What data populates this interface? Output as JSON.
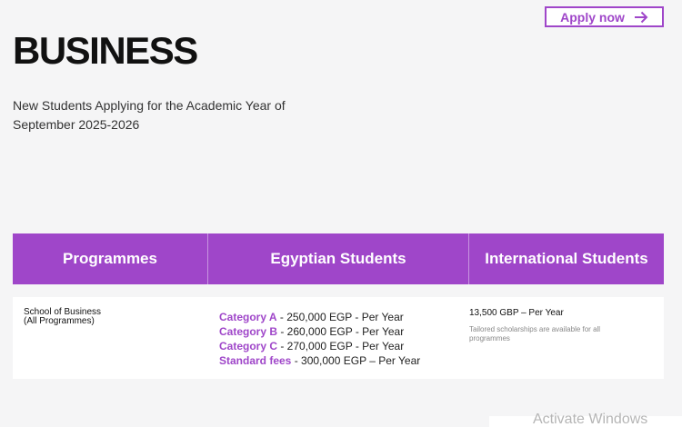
{
  "header": {
    "apply_label": "Apply now"
  },
  "page": {
    "title": "BUSINESS",
    "subtitle": "New Students Applying for the Academic Year of September 2025-2026"
  },
  "table": {
    "headers": [
      "Programmes",
      "Egyptian Students",
      "International Students"
    ],
    "row": {
      "programme_line1": "School of Business",
      "programme_line2": "(All Programmes)",
      "egyptian_fees": [
        {
          "category": "Category A",
          "fee": " - 250,000 EGP - Per Year"
        },
        {
          "category": "Category B",
          "fee": " - 260,000 EGP - Per Year"
        },
        {
          "category": "Category C",
          "fee": " - 270,000 EGP - Per Year"
        },
        {
          "category": "Standard fees",
          "fee": " - 300,000 EGP – Per Year"
        }
      ],
      "international_price": "13,500 GBP – Per Year",
      "international_note": "Tailored scholarships are available for all programmes"
    }
  },
  "overlay": {
    "watermark": "Activate Windows"
  },
  "colors": {
    "accent": "#9f46c9",
    "background": "#f5f5f6"
  },
  "icons": {
    "apply_arrow": "arrow-right-icon"
  }
}
